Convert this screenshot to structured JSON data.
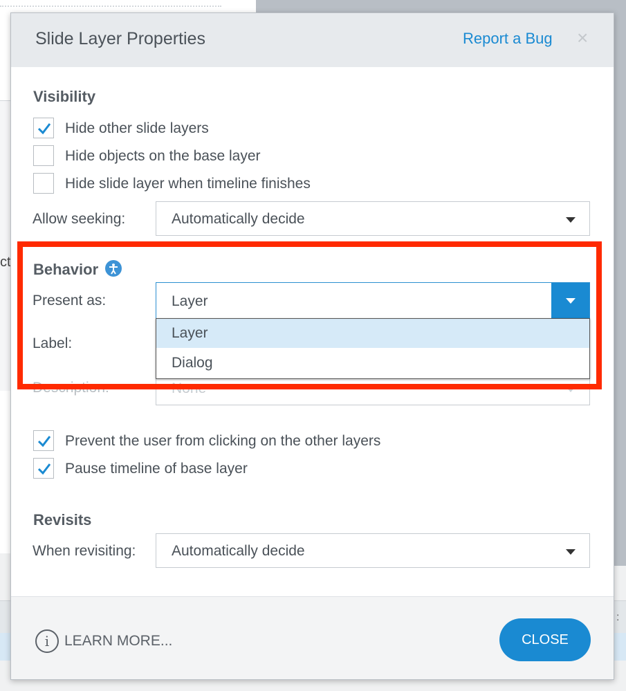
{
  "background": {
    "stub_text": "ct",
    "dots": ":"
  },
  "dialog": {
    "title": "Slide Layer Properties",
    "report_bug": "Report a Bug",
    "close_symbol": "×"
  },
  "visibility": {
    "title": "Visibility",
    "options": [
      {
        "label": "Hide other slide layers",
        "checked": true
      },
      {
        "label": "Hide objects on the base layer",
        "checked": false
      },
      {
        "label": "Hide slide layer when timeline finishes",
        "checked": false
      }
    ],
    "allow_seeking_label": "Allow seeking:",
    "allow_seeking_value": "Automatically decide"
  },
  "behavior": {
    "title": "Behavior",
    "present_as_label": "Present as:",
    "present_as_value": "Layer",
    "present_as_options": [
      "Layer",
      "Dialog"
    ],
    "label_label": "Label:",
    "description_label": "Description:",
    "description_value": "None",
    "options": [
      {
        "label": "Prevent the user from clicking on the other layers",
        "checked": true
      },
      {
        "label": "Pause timeline of base layer",
        "checked": true
      }
    ]
  },
  "revisits": {
    "title": "Revisits",
    "when_label": "When revisiting:",
    "when_value": "Automatically decide"
  },
  "footer": {
    "learn_icon": "i",
    "learn_more": "LEARN MORE...",
    "close": "CLOSE"
  },
  "colors": {
    "accent": "#1a8ad2",
    "highlight": "#ff2a00",
    "selected_item": "#d6eaf8"
  }
}
